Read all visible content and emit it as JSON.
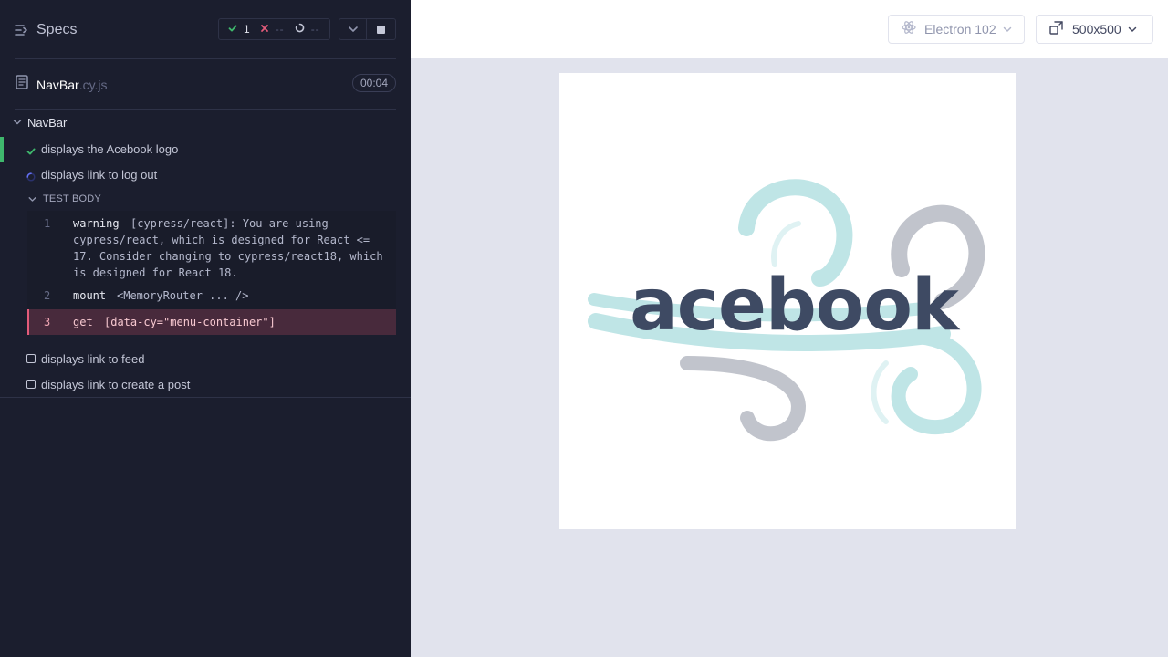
{
  "reporter": {
    "header": {
      "specs_label": "Specs",
      "stats": {
        "passed": "1",
        "failed": "--",
        "pending": "--"
      }
    },
    "spec": {
      "name": "NavBar",
      "ext": ".cy.js",
      "duration": "00:04"
    },
    "suite": {
      "title": "NavBar"
    },
    "tests": [
      {
        "title": "displays the Acebook logo",
        "state": "passed"
      },
      {
        "title": "displays link to log out",
        "state": "running"
      },
      {
        "title": "displays link to feed",
        "state": "pending"
      },
      {
        "title": "displays link to create a post",
        "state": "pending"
      }
    ],
    "test_body": {
      "title": "TEST BODY",
      "commands": [
        {
          "num": "1",
          "name": "warning",
          "message": "[cypress/react]: You are using cypress/react, which is designed for React <= 17. Consider changing to cypress/react18, which is designed for React 18."
        },
        {
          "num": "2",
          "name": "mount",
          "message": "<MemoryRouter ... />"
        },
        {
          "num": "3",
          "name": "get",
          "message": "[data-cy=\"menu-container\"]",
          "state": "failed"
        }
      ]
    }
  },
  "aut": {
    "browser": "Electron 102",
    "viewport": "500x500",
    "logo_text": "acebook"
  },
  "colors": {
    "reporter_bg": "#1b1e2e",
    "pass": "#3fb86d",
    "fail": "#e35b7a",
    "logo_text": "#3e4a63",
    "logo_swirl_teal": "#a9dfe0",
    "logo_swirl_gray": "#a3a8b3"
  }
}
